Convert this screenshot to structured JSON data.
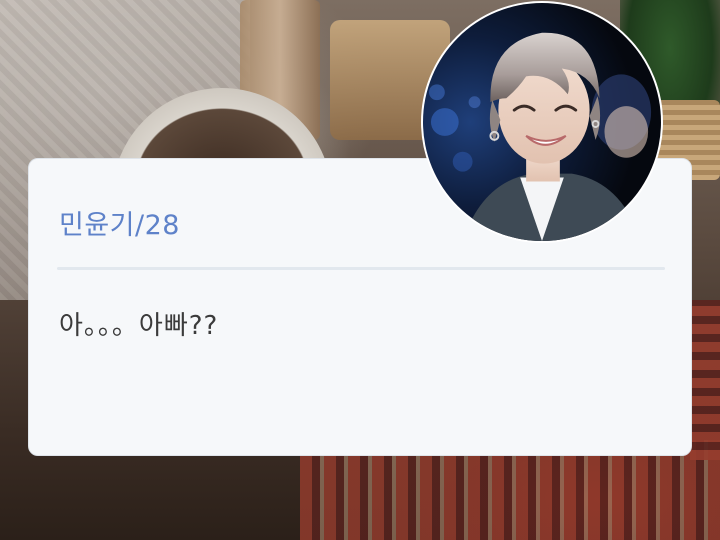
{
  "profile_card": {
    "name_age": "민윤기/28",
    "message": "아。。。아빠??"
  },
  "colors": {
    "name_text": "#5e82c9",
    "message_text": "#3b3b3b",
    "card_background": "#f6f8fa",
    "divider": "#e2e8ee"
  },
  "icons": {
    "avatar": "profile-photo"
  }
}
